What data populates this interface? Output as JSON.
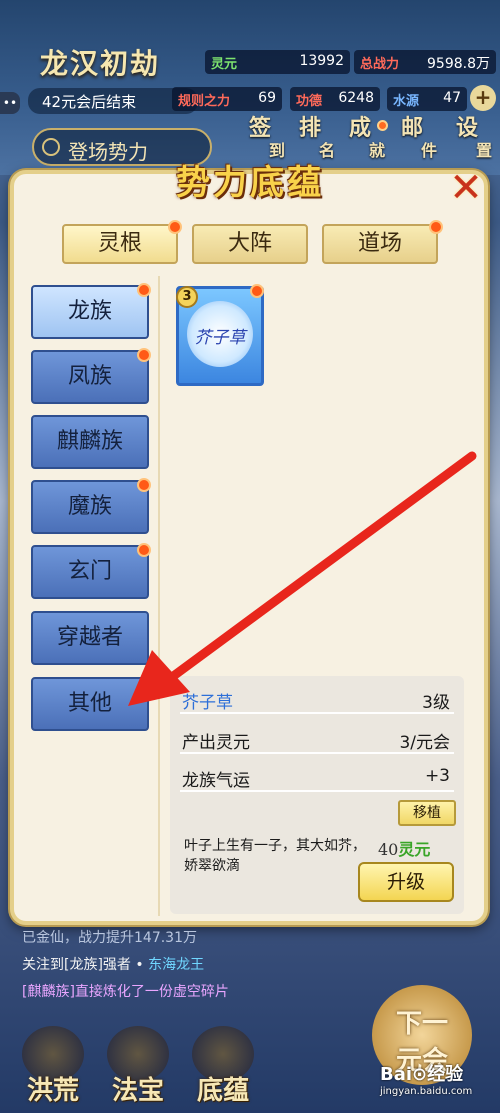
{
  "hud": {
    "title": "龙汉初劫",
    "era_text": "42元会后结束",
    "menu_glyph": "••",
    "stats": {
      "lingyuan_label": "灵元",
      "lingyuan_value": "13992",
      "power_label": "总战力",
      "power_value": "9598.8万",
      "rule_label": "规则之力",
      "rule_value": "69",
      "merit_label": "功德",
      "merit_value": "6248",
      "water_label": "水源",
      "water_value": "47"
    },
    "plus": "+",
    "faction_button": "登场势力",
    "menu": {
      "checkin": [
        "签",
        "到"
      ],
      "rank": [
        "排",
        "名"
      ],
      "achievement": [
        "成",
        "就"
      ],
      "mail": [
        "邮",
        "件"
      ],
      "settings": [
        "设",
        "置"
      ]
    }
  },
  "panel": {
    "title": "势力底蕴",
    "close": "✕",
    "tabs": [
      "灵根",
      "大阵",
      "道场"
    ],
    "sidebar": [
      "龙族",
      "凤族",
      "麒麟族",
      "魔族",
      "玄门",
      "穿越者",
      "其他"
    ],
    "item": {
      "name": "芥子草",
      "level": "3"
    },
    "info": {
      "name": "芥子草",
      "level": "3级",
      "produce_label": "产出灵元",
      "produce_value": "3/元会",
      "luck_label": "龙族气运",
      "luck_value": "+3",
      "move_button": "移植",
      "description": "叶子上生有一子，其大如芥，娇翠欲滴",
      "cost_number": "40",
      "cost_unit": "灵元",
      "upgrade_button": "升级"
    }
  },
  "chat": {
    "line1": "已金仙，战力提升147.31万",
    "line2_prefix": "关注到[龙族]强者 • ",
    "line2_name": "东海龙王",
    "line3": "[麒麟族]直接炼化了一份虚空碎片"
  },
  "bottom_nav": [
    "洪荒",
    "法宝",
    "底蕴"
  ],
  "next_button": [
    "下一",
    "元会"
  ],
  "watermark": {
    "main": "Bai⊙经验",
    "sub": "jingyan.baidu.com"
  },
  "colors": {
    "accent_red": "#e8261c",
    "panel_bg": "#f7f1e2",
    "gold": "#f9d24a",
    "side_blue": "#5b82c8"
  }
}
